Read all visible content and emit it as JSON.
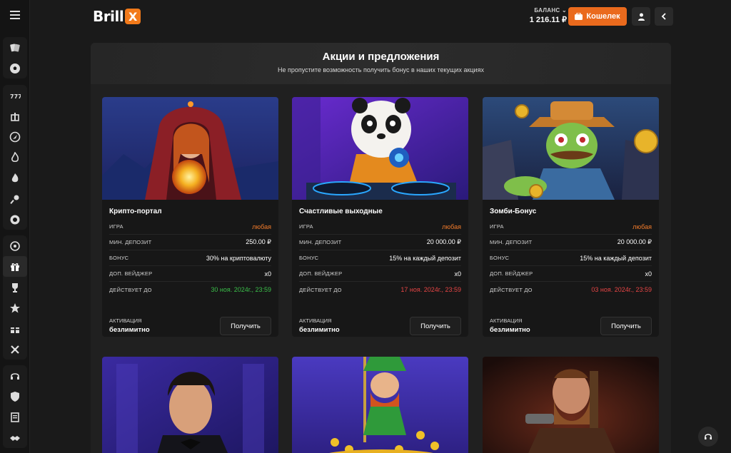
{
  "header": {
    "logo_text": "Brill",
    "logo_x": "X",
    "balance_label": "БАЛАНС ⌄",
    "balance_value": "1 216.11 ₽",
    "wallet_label": "Кошелек"
  },
  "sidebar": {
    "icons": [
      "cards-icon",
      "soccer-ball-icon",
      "slot-777-icon",
      "gift-box-icon",
      "rocket-icon",
      "fire-icon",
      "flame-icon",
      "pin-icon",
      "poker-chip-icon",
      "wheel-icon",
      "gift-icon",
      "trophy-icon",
      "star-icon",
      "present-icon",
      "tools-icon",
      "headset-icon",
      "shield-icon",
      "document-icon",
      "handshake-icon"
    ],
    "active_index": 10
  },
  "page": {
    "title": "Акции и предложения",
    "subtitle": "Не пропустите возможность получить бонус в наших текущих акциях"
  },
  "labels": {
    "game": "ИГРА",
    "min_deposit": "МИН. ДЕПОЗИТ",
    "bonus": "БОНУС",
    "wager": "ДОП. ВЕЙДЖЕР",
    "valid_until": "ДЕЙСТВУЕТ ДО",
    "activation": "АКТИВАЦИЯ",
    "unlimited": "безлимитно",
    "get": "Получить"
  },
  "cards": [
    {
      "title": "Крипто-портал",
      "game": "любая",
      "min_deposit": "250.00 ₽",
      "bonus": "30% на криптовалюту",
      "wager": "x0",
      "valid_until": "30 ноя. 2024г., 23:59",
      "valid_color": "green"
    },
    {
      "title": "Счастливые выходные",
      "game": "любая",
      "min_deposit": "20 000.00 ₽",
      "bonus": "15% на каждый депозит",
      "wager": "x0",
      "valid_until": "17 ноя. 2024г., 23:59",
      "valid_color": "red"
    },
    {
      "title": "Зомби-Бонус",
      "game": "любая",
      "min_deposit": "20 000.00 ₽",
      "bonus": "15% на каждый депозит",
      "wager": "x0",
      "valid_until": "03 ноя. 2024г., 23:59",
      "valid_color": "red"
    }
  ],
  "colors": {
    "accent": "#ea6a1d",
    "green": "#3bbf4a",
    "red": "#e64545"
  }
}
